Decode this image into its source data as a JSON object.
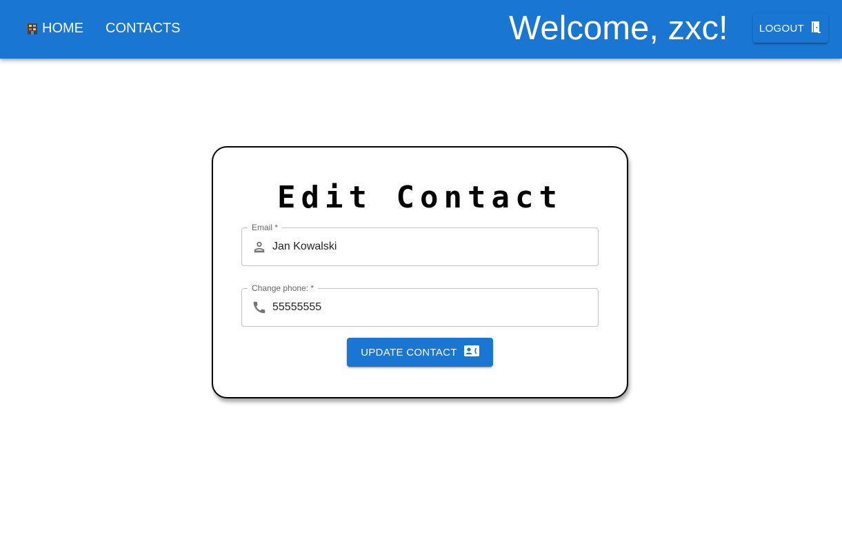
{
  "nav": {
    "home_label": "HOME",
    "home_icon": "home-icon",
    "contacts_label": "CONTACTS",
    "welcome_text": "Welcome, zxc!",
    "logout_label": "LOGOUT",
    "logout_icon": "door-icon"
  },
  "form": {
    "title": "Edit Contact",
    "email": {
      "label": "Email *",
      "value": "Jan Kowalski",
      "icon": "person-icon"
    },
    "phone": {
      "label": "Change phone: *",
      "value": "55555555",
      "icon": "phone-icon"
    },
    "submit_label": "UPDATE CONTACT",
    "submit_icon": "contact-card-icon"
  },
  "colors": {
    "primary": "#1976d2",
    "text_on_primary": "#ffffff",
    "field_border": "#c4c4c4",
    "icon_gray": "#757575"
  }
}
